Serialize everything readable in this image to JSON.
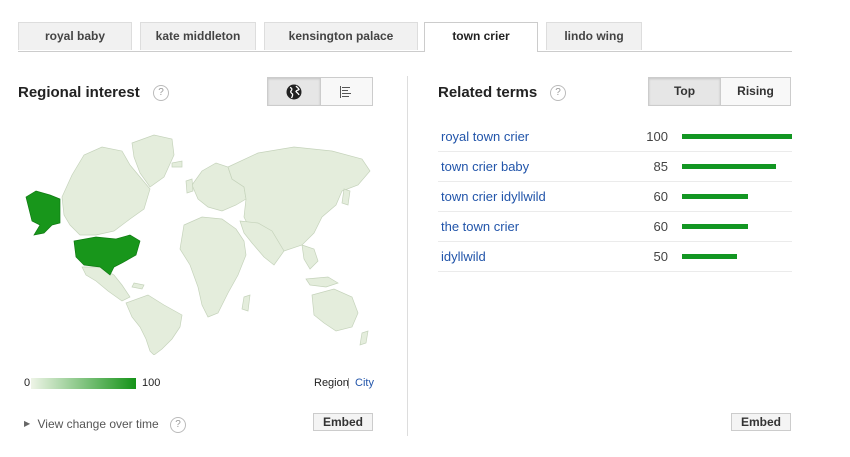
{
  "tabs": [
    {
      "label": "royal baby",
      "active": false
    },
    {
      "label": "kate middleton",
      "active": false
    },
    {
      "label": "kensington palace",
      "active": false
    },
    {
      "label": "town crier",
      "active": true
    },
    {
      "label": "lindo wing",
      "active": false
    }
  ],
  "regional": {
    "title": "Regional interest",
    "help": "?",
    "view_toggle": {
      "options": [
        "globe-icon",
        "list-icon"
      ],
      "selected": "globe-icon"
    },
    "legend": {
      "min": "0",
      "max": "100",
      "low_color": "#eef4e7",
      "high_color": "#159318"
    },
    "region_label": "Region",
    "separator": "|",
    "city_label": "City",
    "view_change_label": "View change over time",
    "embed_label": "Embed",
    "highlighted_region": "United States"
  },
  "related": {
    "title": "Related terms",
    "help": "?",
    "toggle": {
      "top_label": "Top",
      "rising_label": "Rising",
      "selected": "Top"
    },
    "terms": [
      {
        "term": "royal town crier",
        "value": 100
      },
      {
        "term": "town crier baby",
        "value": 85
      },
      {
        "term": "town crier idyllwild",
        "value": 60
      },
      {
        "term": "the town crier",
        "value": 60
      },
      {
        "term": "idyllwild",
        "value": 50
      }
    ],
    "bar_color": "#129622",
    "embed_label": "Embed"
  }
}
